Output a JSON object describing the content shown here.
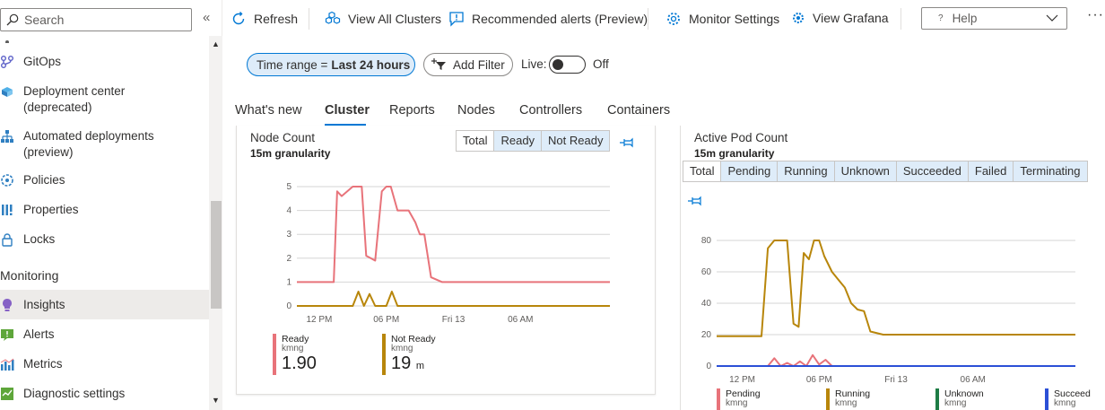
{
  "sidebar": {
    "search_placeholder": "Search",
    "collapse_glyph": "«",
    "items": [
      {
        "label": "GitOps",
        "icon": "gitops-icon"
      },
      {
        "label": "Deployment center",
        "label2": "(deprecated)",
        "icon": "deployment-center-icon"
      },
      {
        "label": "Automated deployments",
        "label2": "(preview)",
        "icon": "automated-deployments-icon"
      },
      {
        "label": "Policies",
        "icon": "policies-icon"
      },
      {
        "label": "Properties",
        "icon": "properties-icon"
      },
      {
        "label": "Locks",
        "icon": "lock-icon"
      }
    ],
    "section_monitoring": "Monitoring",
    "monitoring_items": [
      {
        "label": "Insights",
        "icon": "insights-icon",
        "active": true
      },
      {
        "label": "Alerts",
        "icon": "alerts-icon"
      },
      {
        "label": "Metrics",
        "icon": "metrics-icon"
      },
      {
        "label": "Diagnostic settings",
        "icon": "diagnostic-settings-icon"
      }
    ]
  },
  "toolbar": {
    "refresh": "Refresh",
    "view_all_clusters": "View All Clusters",
    "recommended_alerts": "Recommended alerts (Preview)",
    "monitor_settings": "Monitor Settings",
    "view_grafana": "View Grafana",
    "help": "Help",
    "help_prefix": "?",
    "more": "···"
  },
  "filters": {
    "time_range_prefix": "Time range =",
    "time_range_value": "Last 24 hours",
    "add_filter": "Add Filter",
    "live_label": "Live:",
    "live_state": "Off"
  },
  "tabs": [
    {
      "label": "What's new"
    },
    {
      "label": "Cluster",
      "active": true
    },
    {
      "label": "Reports"
    },
    {
      "label": "Nodes"
    },
    {
      "label": "Controllers"
    },
    {
      "label": "Containers"
    }
  ],
  "node_card": {
    "title": "Node Count",
    "granularity": "15m granularity",
    "segments": [
      "Total",
      "Ready",
      "Not Ready"
    ],
    "legend": [
      {
        "name": "Ready",
        "sub": "kmng",
        "value": "1.90",
        "unit": "",
        "color": "#e8737a"
      },
      {
        "name": "Not Ready",
        "sub": "kmng",
        "value": "19",
        "unit": "m",
        "color": "#b8860b"
      }
    ]
  },
  "pod_card": {
    "title": "Active Pod Count",
    "granularity": "15m granularity",
    "segments": [
      "Total",
      "Pending",
      "Running",
      "Unknown",
      "Succeeded",
      "Failed",
      "Terminating"
    ],
    "legend": [
      {
        "name": "Pending",
        "sub": "kmng",
        "color": "#e8737a"
      },
      {
        "name": "Running",
        "sub": "kmng",
        "color": "#b8860b"
      },
      {
        "name": "Unknown",
        "sub": "kmng",
        "color": "#1e7c45"
      },
      {
        "name": "Succeed",
        "sub": "kmng",
        "color": "#2b4fd6"
      }
    ]
  },
  "chart_data": [
    {
      "type": "line",
      "title": "Node Count",
      "subtitle": "15m granularity",
      "ylim": [
        0,
        5
      ],
      "yticks": [
        0,
        1,
        2,
        3,
        4,
        5
      ],
      "xtick_labels": [
        "12 PM",
        "06 PM",
        "Fri 13",
        "06 AM"
      ],
      "xtick_at": [
        2,
        8,
        14,
        20
      ],
      "x_count": 28,
      "series": [
        {
          "name": "Ready",
          "color": "#e8737a",
          "x": [
            0,
            1,
            2,
            3,
            3.3,
            3.6,
            4,
            5,
            5.5,
            5.8,
            6.2,
            6.6,
            7,
            7.6,
            8,
            8.4,
            9,
            9.6,
            10,
            10.6,
            11,
            11.4,
            12,
            13,
            14,
            20,
            28
          ],
          "y": [
            1,
            1,
            1,
            1,
            1,
            4.8,
            4.6,
            5,
            5,
            5,
            2.1,
            2.0,
            1.9,
            4.8,
            5,
            5,
            4,
            4,
            4,
            3.5,
            3,
            3,
            1.2,
            1,
            1,
            1,
            1
          ]
        },
        {
          "name": "Not Ready",
          "color": "#b8860b",
          "x": [
            0,
            5,
            5.5,
            6,
            6.5,
            7,
            8,
            8.5,
            9,
            10,
            20,
            28
          ],
          "y": [
            0,
            0,
            0.6,
            0,
            0.5,
            0,
            0,
            0.6,
            0,
            0,
            0,
            0
          ]
        }
      ]
    },
    {
      "type": "line",
      "title": "Active Pod Count",
      "subtitle": "15m granularity",
      "ylim": [
        0,
        80
      ],
      "yticks": [
        0,
        20,
        40,
        60,
        80
      ],
      "xtick_labels": [
        "12 PM",
        "06 PM",
        "Fri 13",
        "06 AM"
      ],
      "xtick_at": [
        2,
        8,
        14,
        20
      ],
      "x_count": 28,
      "series": [
        {
          "name": "Running",
          "color": "#b8860b",
          "x": [
            0,
            1,
            2,
            3,
            3.5,
            4,
            4.5,
            5,
            5.5,
            6,
            6.4,
            6.8,
            7.2,
            7.6,
            8,
            8.4,
            9,
            9.5,
            10,
            10.5,
            11,
            11.5,
            12,
            13,
            14,
            20,
            28
          ],
          "y": [
            19,
            19,
            19,
            19,
            19,
            75,
            80,
            80,
            80,
            27,
            25,
            72,
            68,
            80,
            80,
            70,
            60,
            55,
            50,
            40,
            36,
            35,
            22,
            20,
            20,
            20,
            20
          ]
        },
        {
          "name": "Pending",
          "color": "#e8737a",
          "x": [
            0,
            4,
            4.5,
            5,
            5.5,
            6,
            6.5,
            7,
            7.5,
            8,
            8.5,
            9,
            10,
            28
          ],
          "y": [
            0,
            0,
            5,
            0,
            2,
            0,
            3,
            0,
            7,
            1,
            4,
            0,
            0,
            0
          ]
        },
        {
          "name": "Unknown",
          "color": "#1e7c45",
          "x": [
            0,
            28
          ],
          "y": [
            0,
            0
          ]
        },
        {
          "name": "Succeed",
          "color": "#2b4fd6",
          "x": [
            0,
            28
          ],
          "y": [
            0,
            0
          ]
        }
      ]
    }
  ]
}
